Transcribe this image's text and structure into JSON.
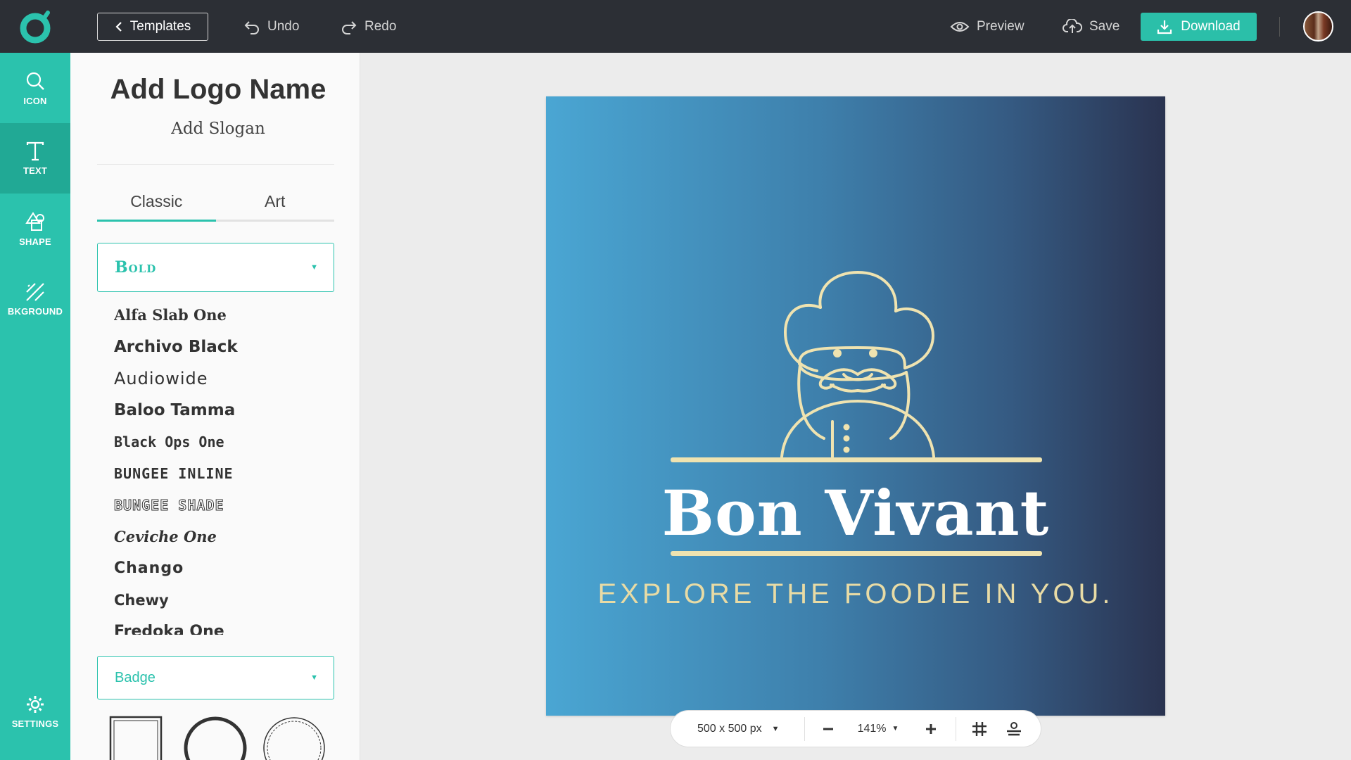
{
  "topbar": {
    "templates_label": "Templates",
    "undo_label": "Undo",
    "redo_label": "Redo",
    "preview_label": "Preview",
    "save_label": "Save",
    "download_label": "Download"
  },
  "rail": {
    "items": [
      {
        "label": "ICON",
        "icon": "search-icon"
      },
      {
        "label": "TEXT",
        "icon": "text-icon"
      },
      {
        "label": "SHAPE",
        "icon": "shapes-icon"
      },
      {
        "label": "BKGROUND",
        "icon": "background-icon"
      }
    ],
    "settings_label": "SETTINGS"
  },
  "panel": {
    "logo_name": "Add Logo Name",
    "slogan": "Add Slogan",
    "tabs": [
      {
        "label": "Classic"
      },
      {
        "label": "Art"
      }
    ],
    "active_tab": "Classic",
    "category_select": "Bold",
    "fonts": [
      "Alfa Slab One",
      "Archivo Black",
      "Audiowide",
      "Baloo Tamma",
      "Black Ops One",
      "BUNGEE INLINE",
      "BUNGEE SHADE",
      "Ceviche One",
      "Chango",
      "Chewy",
      "Fredoka One"
    ],
    "shape_select": "Badge"
  },
  "design": {
    "brand_name": "Bon Vivant",
    "brand_slogan": "EXPLORE THE FOODIE IN YOU.",
    "icon": "chef-icon",
    "colors": {
      "gradient_start": "#4aa6d3",
      "gradient_end": "#2a3350",
      "line_art": "#efe3b0",
      "title": "#ffffff",
      "slogan": "#e8dba5"
    }
  },
  "toolbar": {
    "size_label": "500 x 500 px",
    "zoom_label": "141%"
  },
  "accent": "#2bc2ad"
}
